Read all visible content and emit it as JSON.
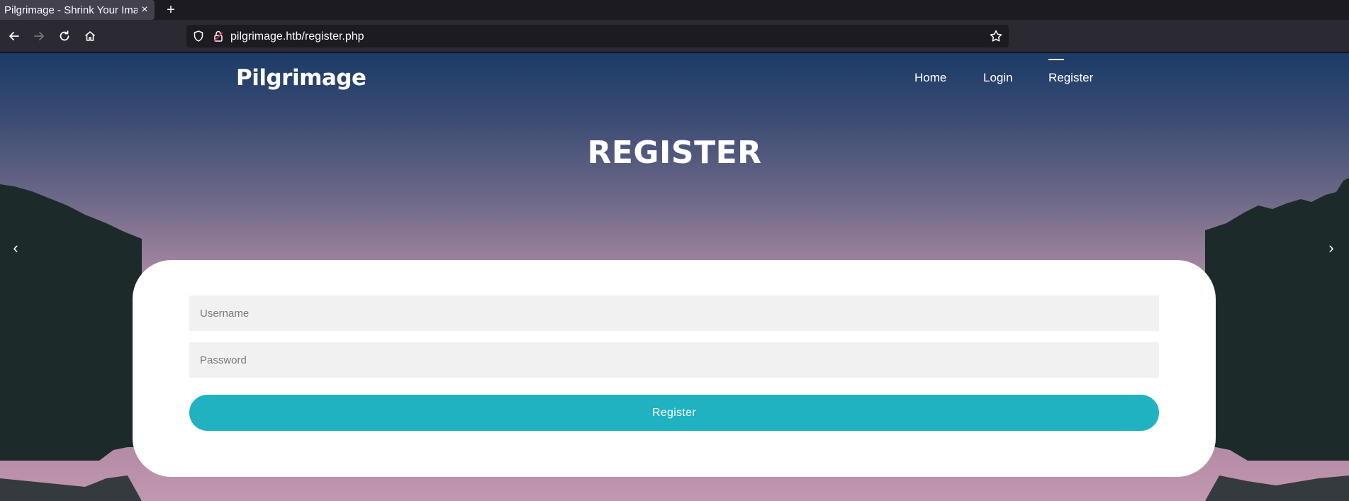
{
  "browser": {
    "tab_title": "Pilgrimage - Shrink Your Images",
    "tab_close": "×",
    "new_tab": "+",
    "url": "pilgrimage.htb/register.php"
  },
  "site": {
    "brand": "Pilgrimage",
    "nav": [
      {
        "label": "Home",
        "active": false
      },
      {
        "label": "Login",
        "active": false
      },
      {
        "label": "Register",
        "active": true
      }
    ],
    "title": "REGISTER",
    "arrow_left": "‹",
    "arrow_right": "›"
  },
  "form": {
    "username_placeholder": "Username",
    "password_placeholder": "Password",
    "submit_label": "Register"
  },
  "colors": {
    "accent": "#20b2c1",
    "field_bg": "#f1f1f1",
    "sky_top": "#1b3b66",
    "sky_bottom": "#b48ba4",
    "mountains": "#1b2b2b"
  },
  "icons": {
    "back": "arrow-left-icon",
    "forward": "arrow-right-icon",
    "reload": "reload-icon",
    "home": "home-icon",
    "shield": "shield-icon",
    "lock": "lock-icon",
    "bookmark": "star-icon"
  }
}
